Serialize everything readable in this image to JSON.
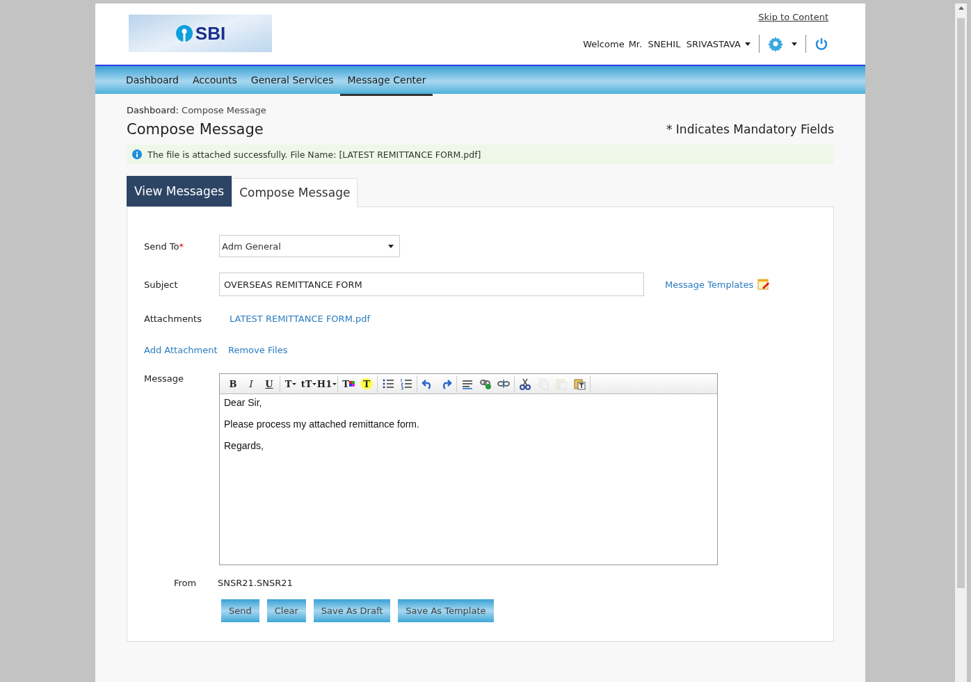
{
  "header": {
    "logo": "SBI",
    "skip_link": "Skip to Content",
    "welcome": "Welcome",
    "user": "Mr.  SNEHIL  SRIVASTAVA"
  },
  "nav": [
    {
      "label": "Dashboard",
      "selected": false
    },
    {
      "label": "Accounts",
      "selected": false
    },
    {
      "label": "General Services",
      "selected": false
    },
    {
      "label": "Message Center",
      "selected": true
    }
  ],
  "breadcrumb": {
    "root": "Dashboard:",
    "current": "Compose Message"
  },
  "page_title": "Compose Message",
  "mandatory_note": "* Indicates Mandatory Fields",
  "notice": "The file is attached successfully. File Name: [LATEST REMITTANCE FORM.pdf]",
  "tabs": [
    {
      "label": "View Messages",
      "selected": false
    },
    {
      "label": "Compose Message",
      "selected": true
    }
  ],
  "form": {
    "send_to": {
      "label": "Send To",
      "required_mark": "*",
      "value": "Adm General"
    },
    "subject": {
      "label": "Subject",
      "value": "OVERSEAS REMITTANCE FORM"
    },
    "templates_link": "Message Templates",
    "attachments": {
      "label": "Attachments",
      "file": "LATEST REMITTANCE FORM.pdf"
    },
    "add_attachment": "Add Attachment",
    "remove_files": "Remove Files",
    "message": {
      "label": "Message",
      "lines": [
        "Dear Sir,",
        "Please process my attached remittance form.",
        "Regards,"
      ]
    },
    "from": {
      "label": "From",
      "value": "SNSR21.SNSR21"
    }
  },
  "toolbar": [
    [
      {
        "kind": "bold",
        "label": "B",
        "disabled": false
      },
      {
        "kind": "italic",
        "label": "I",
        "disabled": false
      },
      {
        "kind": "underline",
        "label": "U",
        "disabled": false
      }
    ],
    [
      {
        "kind": "font",
        "label": "T",
        "disabled": false
      },
      {
        "kind": "size",
        "label": "tT",
        "disabled": false
      },
      {
        "kind": "heading",
        "label": "H1",
        "disabled": false
      }
    ],
    [
      {
        "kind": "color",
        "label": "T",
        "disabled": false
      },
      {
        "kind": "highlight",
        "label": "T",
        "disabled": false
      }
    ],
    [
      {
        "kind": "bullets",
        "disabled": false
      },
      {
        "kind": "numbers",
        "disabled": false
      }
    ],
    [
      {
        "kind": "undo",
        "disabled": false
      },
      {
        "kind": "redo",
        "disabled": false
      }
    ],
    [
      {
        "kind": "rule",
        "disabled": false
      },
      {
        "kind": "link",
        "disabled": false
      },
      {
        "kind": "unlink",
        "disabled": false
      }
    ],
    [
      {
        "kind": "cut",
        "disabled": false
      },
      {
        "kind": "copy",
        "disabled": true
      },
      {
        "kind": "paste",
        "disabled": true
      },
      {
        "kind": "paste-text",
        "disabled": false
      }
    ]
  ],
  "buttons": [
    "Send",
    "Clear",
    "Save As Draft",
    "Save As Template"
  ]
}
